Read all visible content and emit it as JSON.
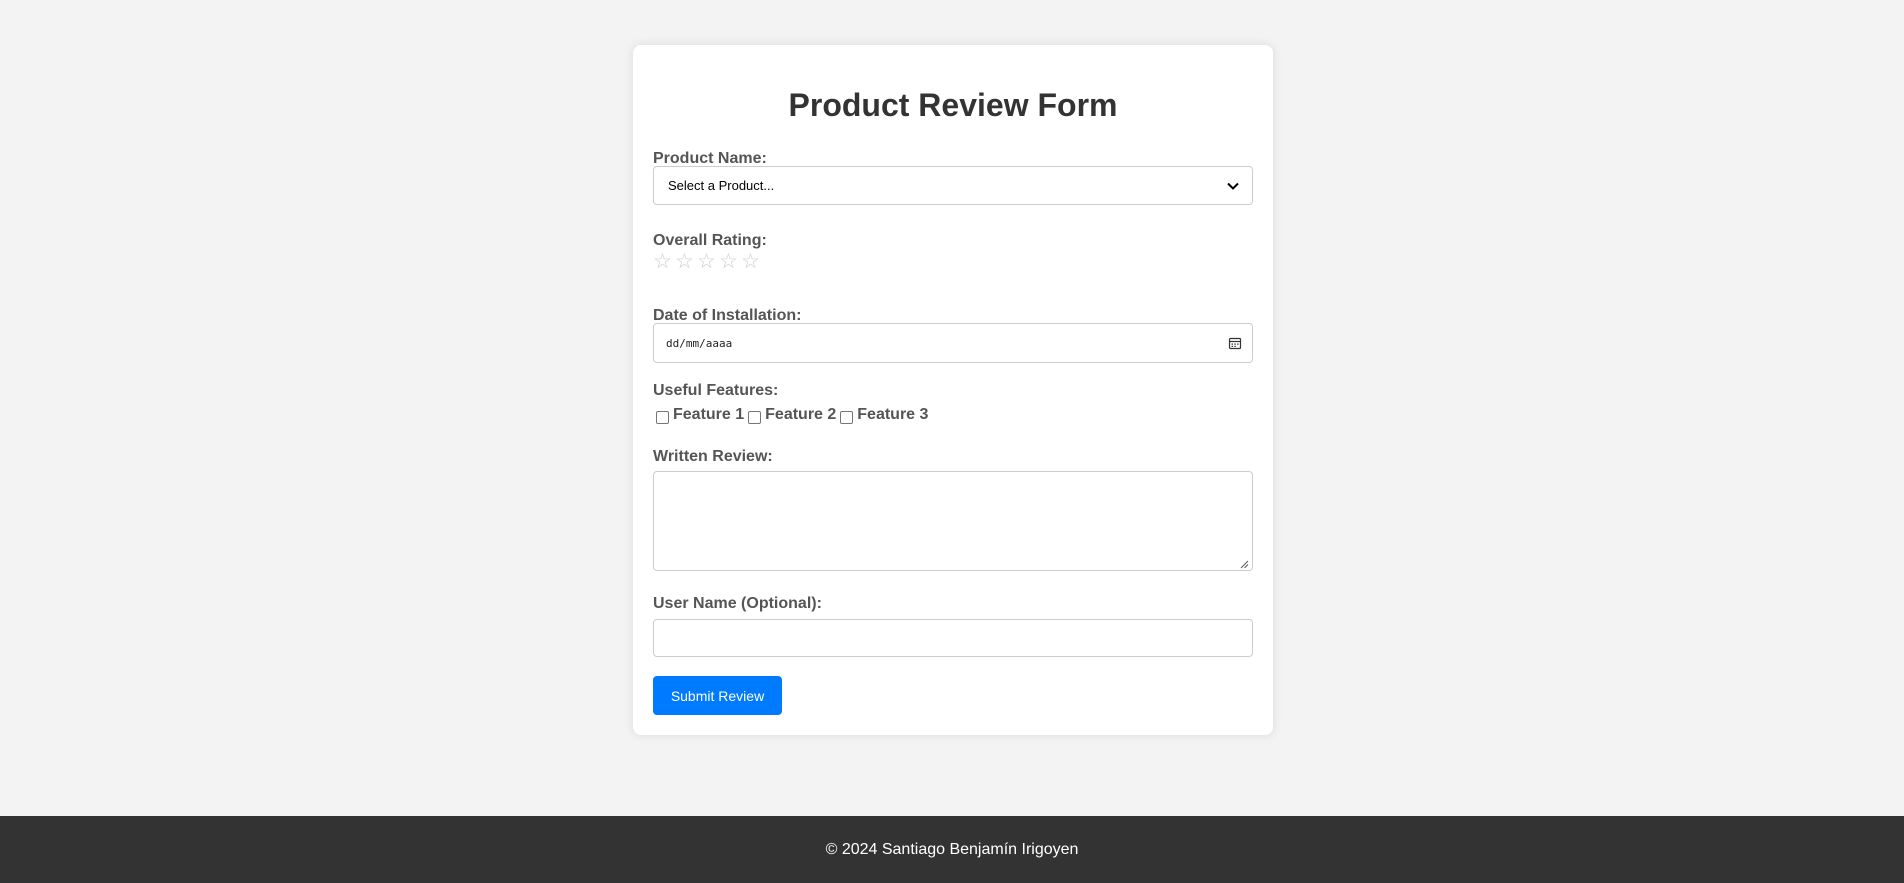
{
  "form": {
    "title": "Product Review Form",
    "product_label": "Product Name:",
    "product_select_value": "Select a Product...",
    "rating_label": "Overall Rating:",
    "rating_stars": [
      "☆",
      "☆",
      "☆",
      "☆",
      "☆"
    ],
    "rating_value": 0,
    "rating_max": 5,
    "date_label": "Date of Installation:",
    "date_placeholder": "dd/mm/aaaa",
    "features_label": "Useful Features:",
    "features": [
      {
        "label": "Feature 1",
        "checked": false
      },
      {
        "label": "Feature 2",
        "checked": false
      },
      {
        "label": "Feature 3",
        "checked": false
      }
    ],
    "review_label": "Written Review:",
    "review_value": "",
    "username_label": "User Name (Optional):",
    "username_value": "",
    "submit_label": "Submit Review"
  },
  "footer": {
    "text": "© 2024 Santiago Benjamín Irigoyen"
  },
  "colors": {
    "background": "#f3f3f3",
    "card": "#ffffff",
    "accent": "#007bff",
    "footer": "#333333",
    "star_empty": "#cccccc",
    "label": "#555555",
    "title": "#333333"
  },
  "icons": {
    "select": "chevron-down-icon",
    "date": "calendar-icon",
    "rating": "star-icon",
    "textarea": "resize-handle-icon"
  }
}
